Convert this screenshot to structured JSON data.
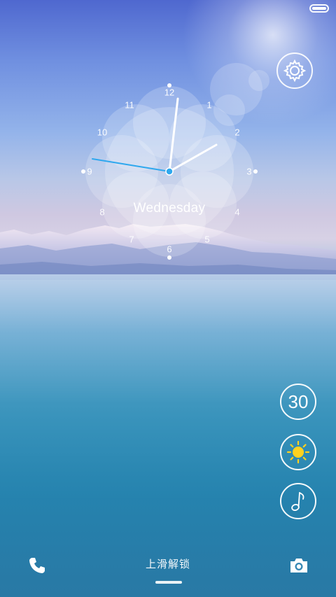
{
  "status_bar": {
    "battery_level": 1.0
  },
  "clock": {
    "numbers": [
      "12",
      "1",
      "2",
      "3",
      "4",
      "5",
      "6",
      "7",
      "8",
      "9",
      "10",
      "11"
    ],
    "weekday": "Wednesday"
  },
  "widgets": {
    "date_label": "30",
    "weather_icon": "sun-icon",
    "music_icon": "music-note-icon"
  },
  "bottom_bar": {
    "unlock_hint": "上滑解锁",
    "left_icon": "phone-icon",
    "right_icon": "camera-icon"
  },
  "colors": {
    "accent": "#2fa8ee",
    "sun": "#ffd21f"
  }
}
